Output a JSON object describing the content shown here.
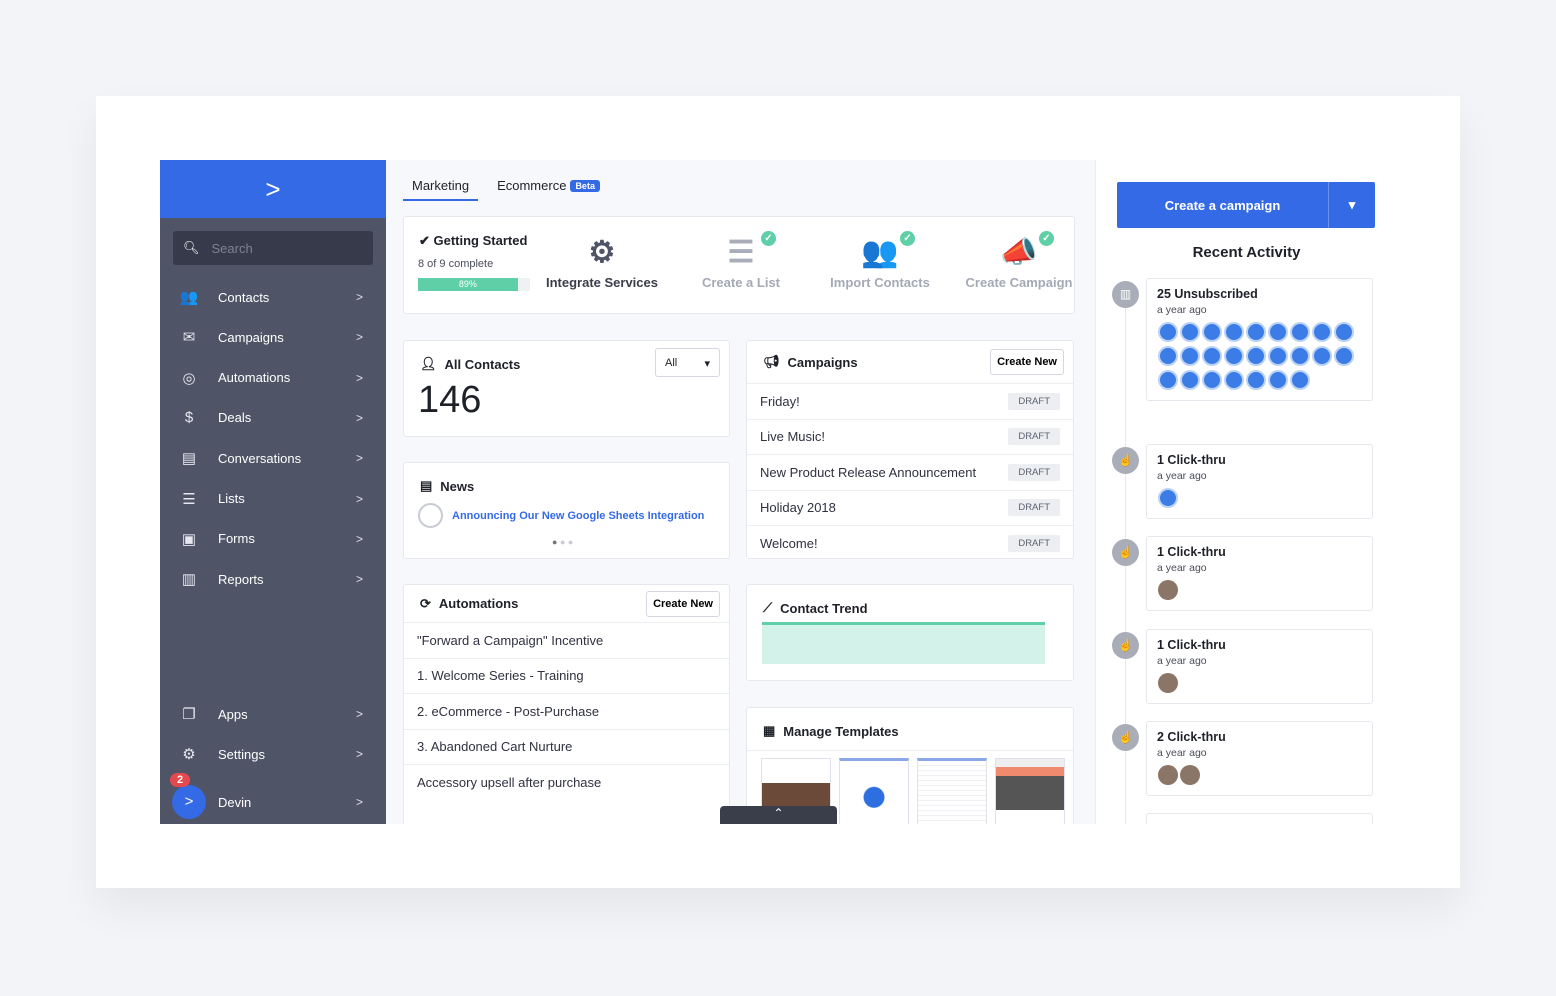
{
  "sidebar": {
    "search_placeholder": "Search",
    "items": [
      {
        "label": "Contacts",
        "icon": "contacts-icon",
        "glyph": "👥"
      },
      {
        "label": "Campaigns",
        "icon": "envelope-icon",
        "glyph": "✉"
      },
      {
        "label": "Automations",
        "icon": "automations-icon",
        "glyph": "◎"
      },
      {
        "label": "Deals",
        "icon": "dollar-icon",
        "glyph": "$"
      },
      {
        "label": "Conversations",
        "icon": "chat-icon",
        "glyph": "▤"
      },
      {
        "label": "Lists",
        "icon": "list-icon",
        "glyph": "☰"
      },
      {
        "label": "Forms",
        "icon": "forms-icon",
        "glyph": "▣"
      },
      {
        "label": "Reports",
        "icon": "reports-icon",
        "glyph": "▥"
      }
    ],
    "bottom": [
      {
        "label": "Apps",
        "icon": "apps-icon",
        "glyph": "❐"
      },
      {
        "label": "Settings",
        "icon": "gear-icon",
        "glyph": "⚙"
      }
    ],
    "user": {
      "name": "Devin",
      "badge": "2"
    }
  },
  "tabs": [
    {
      "label": "Marketing"
    },
    {
      "label": "Ecommerce",
      "badge": "Beta"
    }
  ],
  "getting_started": {
    "title": "✔ Getting Started",
    "progress_text": "8 of 9 complete",
    "percent": 89,
    "percent_label": "89%",
    "steps": [
      {
        "label": "Integrate Services",
        "done": false,
        "glyph": "⚙"
      },
      {
        "label": "Create a List",
        "done": true,
        "glyph": "☰"
      },
      {
        "label": "Import Contacts",
        "done": true,
        "glyph": "👥"
      },
      {
        "label": "Create Campaign",
        "done": true,
        "glyph": "📣"
      }
    ]
  },
  "contacts": {
    "title": "All Contacts",
    "filter": "All",
    "count": "146"
  },
  "news": {
    "title": "News",
    "headline": "Announcing Our New Google Sheets Integration"
  },
  "campaigns": {
    "title": "Campaigns",
    "create": "Create New",
    "items": [
      {
        "name": "Friday!",
        "status": "DRAFT"
      },
      {
        "name": "Live Music!",
        "status": "DRAFT"
      },
      {
        "name": "New Product Release Announcement",
        "status": "DRAFT"
      },
      {
        "name": "Holiday 2018",
        "status": "DRAFT"
      },
      {
        "name": "Welcome!",
        "status": "DRAFT"
      }
    ]
  },
  "automations": {
    "title": "Automations",
    "create": "Create New",
    "items": [
      "\"Forward a Campaign\" Incentive",
      "1. Welcome Series - Training",
      "2. eCommerce - Post-Purchase",
      "3. Abandoned Cart Nurture",
      "Accessory upsell after purchase"
    ]
  },
  "trend": {
    "title": "Contact Trend"
  },
  "templates": {
    "title": "Manage Templates"
  },
  "right": {
    "create": "Create a campaign",
    "title": "Recent Activity",
    "activities": [
      {
        "title": "25 Unsubscribed",
        "time": "a year ago",
        "avatars": 25
      },
      {
        "title": "1 Click-thru",
        "time": "a year ago",
        "avatars": 1
      },
      {
        "title": "1 Click-thru",
        "time": "a year ago",
        "avatars": 1
      },
      {
        "title": "1 Click-thru",
        "time": "a year ago",
        "avatars": 1
      },
      {
        "title": "2 Click-thru",
        "time": "a year ago",
        "avatars": 2
      }
    ]
  },
  "colors": {
    "brand": "#356ae6",
    "sidebar": "#4f5467",
    "success": "#5ecfa6"
  }
}
